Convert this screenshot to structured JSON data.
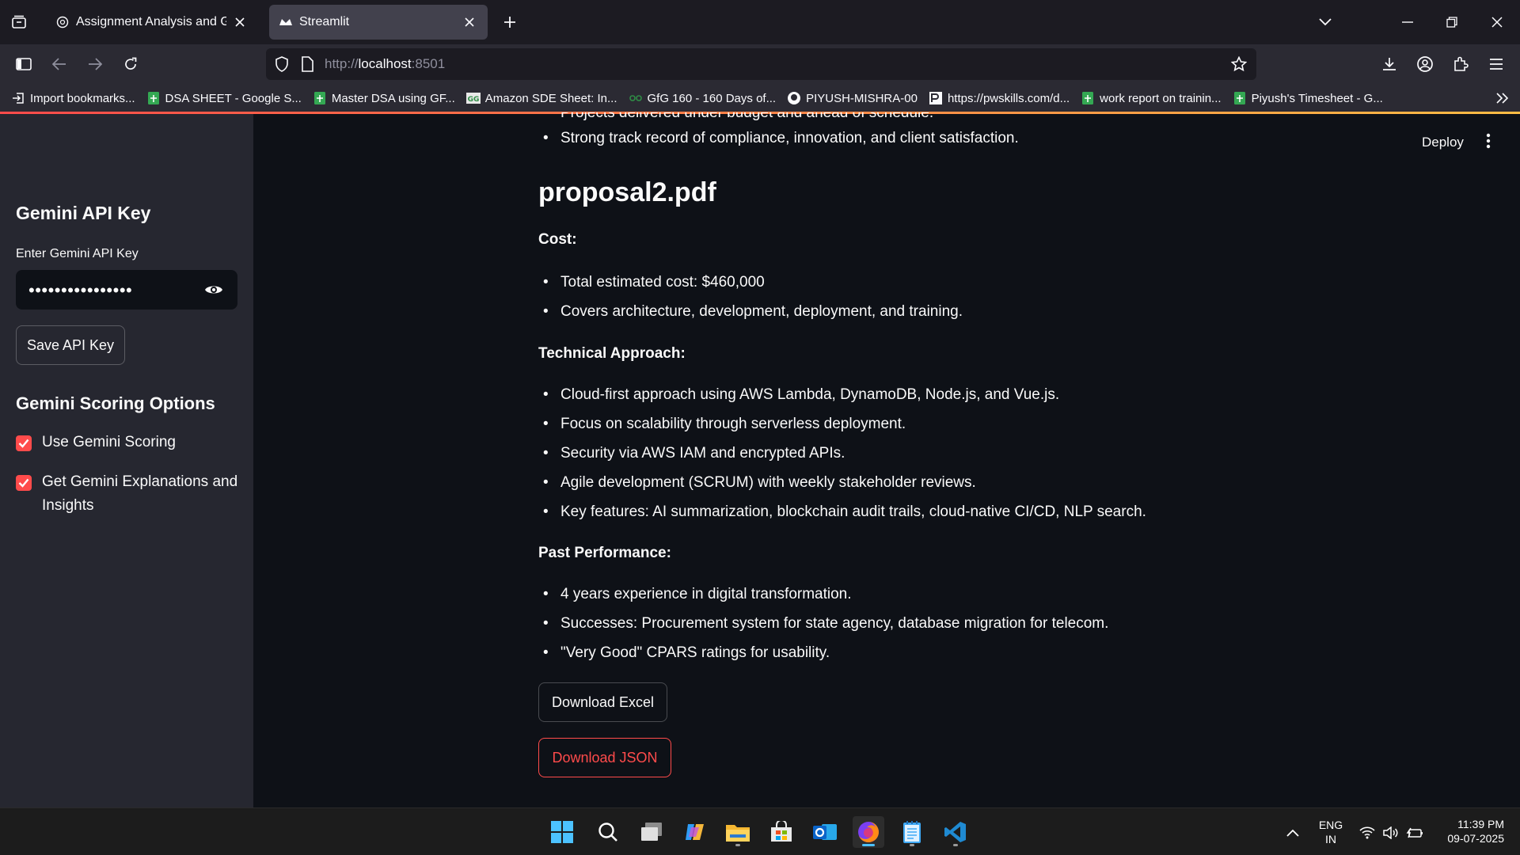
{
  "browser": {
    "tabs": [
      {
        "title": "Assignment Analysis and Guida"
      },
      {
        "title": "Streamlit"
      }
    ],
    "url": {
      "scheme": "http://",
      "host": "localhost",
      "port": ":8501"
    },
    "bookmarks": [
      {
        "label": "Import bookmarks...",
        "icon": "import-icon"
      },
      {
        "label": "DSA SHEET - Google S...",
        "icon": "sheets-icon"
      },
      {
        "label": "Master DSA using GF...",
        "icon": "sheets-icon"
      },
      {
        "label": "Amazon SDE Sheet: In...",
        "icon": "gfg-icon"
      },
      {
        "label": "GfG 160 - 160 Days of...",
        "icon": "gfg-icon"
      },
      {
        "label": "PIYUSH-MISHRA-00",
        "icon": "github-icon"
      },
      {
        "label": "https://pwskills.com/d...",
        "icon": "pw-icon"
      },
      {
        "label": "work report on trainin...",
        "icon": "sheets-icon"
      },
      {
        "label": "Piyush's Timesheet - G...",
        "icon": "sheets-icon"
      }
    ]
  },
  "sidebar": {
    "api_heading": "Gemini API Key",
    "api_label": "Enter Gemini API Key",
    "api_value": "••••••••••••••••",
    "save_button": "Save API Key",
    "options_heading": "Gemini Scoring Options",
    "options": [
      {
        "label": "Use Gemini Scoring",
        "checked": true
      },
      {
        "label": "Get Gemini Explanations and Insights",
        "checked": true
      }
    ]
  },
  "header": {
    "deploy": "Deploy"
  },
  "main": {
    "cut_line": "Projects delivered under budget and ahead of schedule.",
    "prev_last_item": "Strong track record of compliance, innovation, and client satisfaction.",
    "doc_title": "proposal2.pdf",
    "cost_heading": "Cost:",
    "cost_items": [
      "Total estimated cost: $460,000",
      "Covers architecture, development, deployment, and training."
    ],
    "tech_heading": "Technical Approach:",
    "tech_items": [
      "Cloud-first approach using AWS Lambda, DynamoDB, Node.js, and Vue.js.",
      "Focus on scalability through serverless deployment.",
      "Security via AWS IAM and encrypted APIs.",
      "Agile development (SCRUM) with weekly stakeholder reviews.",
      "Key features: AI summarization, blockchain audit trails, cloud-native CI/CD, NLP search."
    ],
    "past_heading": "Past Performance:",
    "past_items": [
      "4 years experience in digital transformation.",
      "Successes: Procurement system for state agency, database migration for telecom.",
      "\"Very Good\" CPARS ratings for usability."
    ],
    "download_excel": "Download Excel",
    "download_json": "Download JSON"
  },
  "taskbar": {
    "language": "ENG",
    "region": "IN",
    "time": "11:39 PM",
    "date": "09-07-2025"
  },
  "colors": {
    "accent": "#ff4b4b",
    "sidebar_bg": "#262730",
    "app_bg": "#0e1117"
  }
}
